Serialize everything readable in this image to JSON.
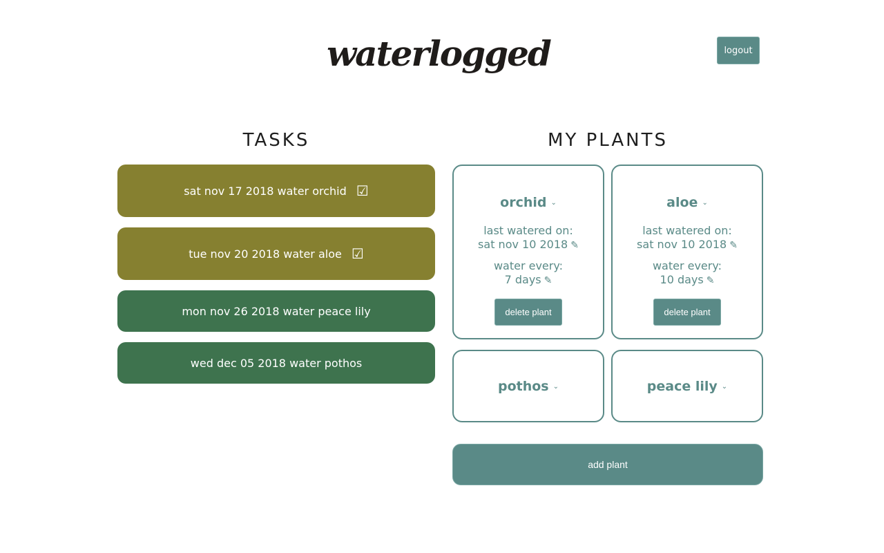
{
  "header": {
    "logo_text": "waterlogged",
    "logout_label": "logout"
  },
  "tasks": {
    "title": "TASKS",
    "items": [
      {
        "text": "sat nov 17 2018 water orchid",
        "check": "☑"
      },
      {
        "text": "tue nov 20 2018 water aloe",
        "check": "☑"
      },
      {
        "text": "mon nov 26 2018 water peace lily"
      },
      {
        "text": "wed dec 05 2018 water pothos"
      }
    ]
  },
  "plants": {
    "title": "MY PLANTS",
    "items": [
      {
        "name": "orchid",
        "chevron": "⌄",
        "last_watered_label": "last watered on:",
        "last_watered_value": "sat nov 10 2018",
        "water_every_label": "water every:",
        "water_every_value": "7 days",
        "edit_icon": "✎",
        "delete_label": "delete plant"
      },
      {
        "name": "aloe",
        "chevron": "⌄",
        "last_watered_label": "last watered on:",
        "last_watered_value": "sat nov 10 2018",
        "water_every_label": "water every:",
        "water_every_value": "10 days",
        "edit_icon": "✎",
        "delete_label": "delete plant"
      },
      {
        "name": "pothos",
        "chevron": "⌄"
      },
      {
        "name": "peace lily",
        "chevron": "⌄"
      }
    ],
    "add_label": "add plant"
  },
  "colors": {
    "accent_teal": "#5a8a87",
    "task_due_olive": "#868030",
    "task_future_green": "#3e734e"
  }
}
